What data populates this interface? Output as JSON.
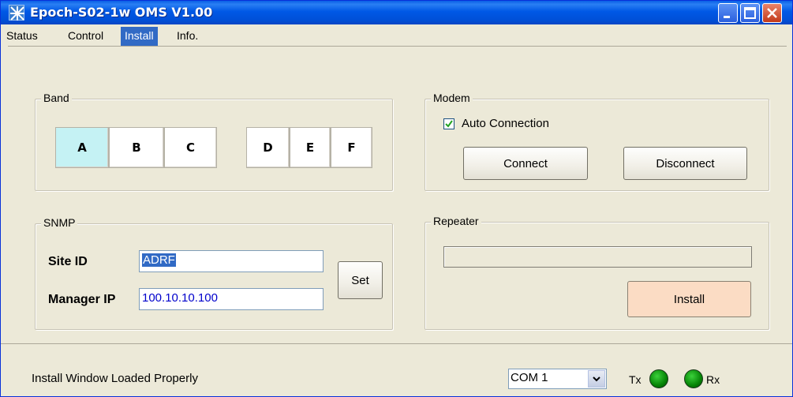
{
  "window": {
    "title": "Epoch-S02-1w OMS V1.00"
  },
  "menu": [
    "Status",
    "Control",
    "Install",
    "Info."
  ],
  "menu_active": "Install",
  "band": {
    "label": "Band",
    "buttons": [
      "A",
      "B",
      "C",
      "D",
      "E",
      "F"
    ],
    "selected": "A"
  },
  "modem": {
    "label": "Modem",
    "auto_connection_label": "Auto Connection",
    "auto_connection_checked": true,
    "connect_label": "Connect",
    "disconnect_label": "Disconnect"
  },
  "snmp": {
    "label": "SNMP",
    "site_id_label": "Site ID",
    "site_id_value": "ADRF",
    "manager_ip_label": "Manager IP",
    "manager_ip_value": "100.10.10.100",
    "set_label": "Set"
  },
  "repeater": {
    "label": "Repeater",
    "progress": 0,
    "install_label": "Install"
  },
  "status": {
    "text": "Install Window Loaded Properly",
    "port": "COM 1",
    "tx_label": "Tx",
    "rx_label": "Rx"
  },
  "colors": {
    "titlebar": "#0058e6",
    "menu_active": "#316ac5",
    "band_selected": "#c5f2f4",
    "install_button": "#fbdcc4",
    "led": "#068406"
  }
}
